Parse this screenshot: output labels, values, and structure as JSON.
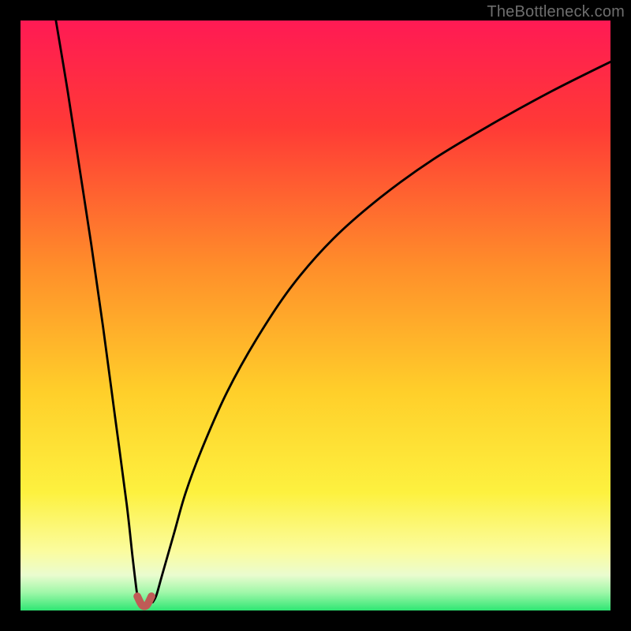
{
  "watermark": "TheBottleneck.com",
  "colors": {
    "frame": "#000000",
    "grad_top": "#ff1a54",
    "grad_upper": "#ff3f2e",
    "grad_mid": "#ffcf2a",
    "grad_pale": "#fffcb3",
    "grad_green": "#2fe673",
    "curve_main": "#000000",
    "blob": "#bf5b56"
  },
  "chart_data": {
    "type": "line",
    "title": "",
    "xlabel": "",
    "ylabel": "",
    "xlim": [
      0,
      100
    ],
    "ylim": [
      0,
      100
    ],
    "series": [
      {
        "name": "left-branch",
        "x": [
          6,
          8,
          10,
          12,
          14,
          16,
          18,
          19,
          19.8,
          20.2
        ],
        "y": [
          100,
          88,
          75,
          62,
          48,
          33,
          18,
          9,
          2.5,
          1.4
        ]
      },
      {
        "name": "right-branch",
        "x": [
          22.4,
          23,
          24,
          26,
          28,
          31,
          35,
          40,
          46,
          53,
          61,
          70,
          80,
          90,
          100
        ],
        "y": [
          1.4,
          2.5,
          6,
          13,
          20,
          28,
          37,
          46,
          55,
          63,
          70,
          76.5,
          82.5,
          88,
          93
        ]
      },
      {
        "name": "trough-blob",
        "x": [
          19.8,
          20.6,
          21.4,
          22.2
        ],
        "y": [
          2.4,
          0.9,
          0.9,
          2.4
        ]
      }
    ],
    "annotations": [
      {
        "text": "TheBottleneck.com",
        "position": "top-right"
      }
    ]
  }
}
